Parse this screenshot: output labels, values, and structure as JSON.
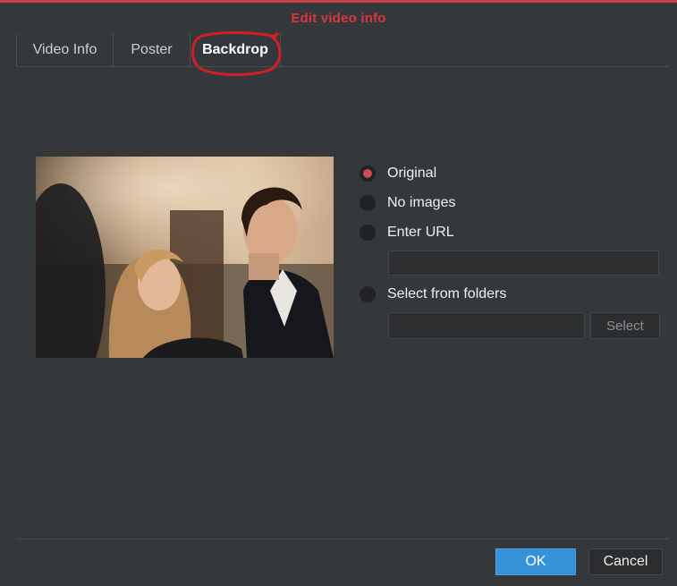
{
  "dialog": {
    "title": "Edit video info"
  },
  "tabs": [
    {
      "label": "Video Info",
      "active": false
    },
    {
      "label": "Poster",
      "active": false
    },
    {
      "label": "Backdrop",
      "active": true
    }
  ],
  "options": {
    "original": {
      "label": "Original",
      "checked": true
    },
    "no_images": {
      "label": "No images",
      "checked": false
    },
    "enter_url": {
      "label": "Enter URL",
      "checked": false,
      "value": ""
    },
    "select_folders": {
      "label": "Select from folders",
      "checked": false,
      "value": "",
      "button_label": "Select"
    }
  },
  "footer": {
    "ok_label": "OK",
    "cancel_label": "Cancel"
  },
  "colors": {
    "accent_red": "#d9363e",
    "radio_checked": "#d24b52",
    "ok_blue": "#3592d8",
    "background": "#35383b"
  }
}
